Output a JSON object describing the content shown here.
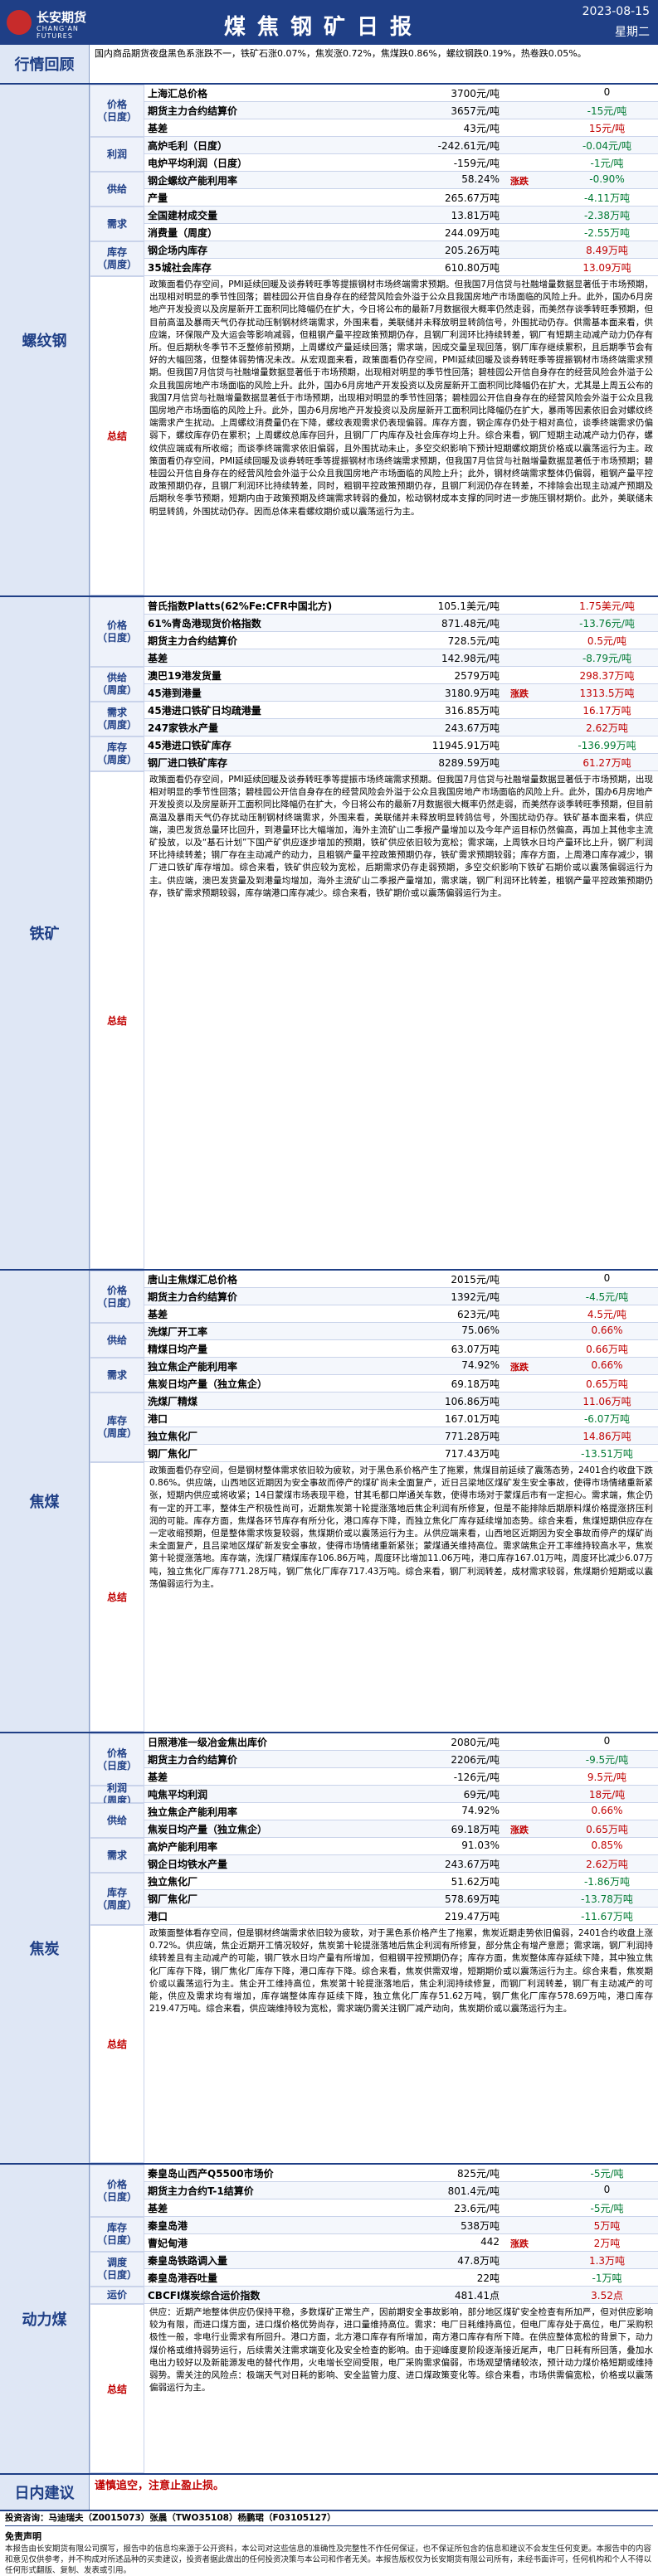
{
  "header": {
    "logo_name": "长安期货",
    "logo_en": "CHANG'AN FUTURES",
    "title": "煤焦钢矿日报",
    "date": "2023-08-15",
    "weekday": "星期二"
  },
  "colors": {
    "brand": "#1f3f86",
    "up": "#c00000",
    "down": "#007a33"
  },
  "market_review": {
    "label": "行情回顾",
    "text": "国内商品期货夜盘黑色系涨跌不一，铁矿石涨0.07%，焦炭涨0.72%，焦煤跌0.86%，螺纹钢跌0.19%，热卷跌0.05%。"
  },
  "rebar": {
    "label": "螺纹钢",
    "groups": [
      {
        "name": "价格\n（日度）",
        "start": 0,
        "count": 3
      },
      {
        "name": "利润",
        "start": 3,
        "count": 2
      },
      {
        "name": "供给",
        "start": 5,
        "count": 2
      },
      {
        "name": "需求",
        "start": 7,
        "count": 2
      },
      {
        "name": "库存\n（周度）",
        "start": 9,
        "count": 2
      }
    ],
    "trend_label": "涨跌",
    "rows": [
      {
        "label": "上海汇总价格",
        "value": "3700元/吨",
        "change": "0",
        "dir": "flat"
      },
      {
        "label": "期货主力合约结算价",
        "value": "3657元/吨",
        "change": "-15元/吨",
        "dir": "dn"
      },
      {
        "label": "基差",
        "value": "43元/吨",
        "change": "15元/吨",
        "dir": "up"
      },
      {
        "label": "高炉毛利（日度）",
        "value": "-242.61元/吨",
        "change": "-0.04元/吨",
        "dir": "dn"
      },
      {
        "label": "电炉平均利润（日度）",
        "value": "-159元/吨",
        "change": "-1元/吨",
        "dir": "dn"
      },
      {
        "label": "钢企螺纹产能利用率",
        "value": "58.24%",
        "change": "-0.90%",
        "dir": "dn"
      },
      {
        "label": "产量",
        "value": "265.67万吨",
        "change": "-4.11万吨",
        "dir": "dn"
      },
      {
        "label": "全国建材成交量",
        "value": "13.81万吨",
        "change": "-2.38万吨",
        "dir": "dn"
      },
      {
        "label": "消费量（周度）",
        "value": "244.09万吨",
        "change": "-2.55万吨",
        "dir": "dn"
      },
      {
        "label": "钢企场内库存",
        "value": "205.26万吨",
        "change": "8.49万吨",
        "dir": "up"
      },
      {
        "label": "35城社会库存",
        "value": "610.80万吨",
        "change": "13.09万吨",
        "dir": "up"
      }
    ],
    "summary_label": "总结",
    "summary": "政策面看仍存空间，PMI延续回暖及谈券转旺季等提振钢材市场终端需求预期。但我国7月信贷与社融增量数据显著低于市场预期，出现相对明显的季节性回落；碧桂园公开信自身存在的经营风险会外溢于公众且我国房地产市场面临的风险上升。此外，国办6月房地产开发投资以及房屋新开工面积同比降幅仍在扩大，今日将公布的最新7月数据很大概率仍然走弱，而美然存谈季转旺季预期，但目前高温及暴雨天气仍存扰动压制钢材终端需求，外围来看，美联储并未释放明显转鸽信号，外围扰动仍存。供需基本面来看，供应端，环保限产及大运会等影响减弱，但粗钢产量平控政策预期仍存，且钢厂利润环比持续转差，钢厂有短期主动减产动力仍存有所。但后期秋冬季节不乏整修前预期，上周螺纹产量延续回落；需求端，因成交量呈现回落，钢厂库存继续累积，且后期季节会有好的大幅回落，但整体弱势情况未改。从宏观面来看，政策面看仍存空间，PMI延续回暖及谈券转旺季等提振钢材市场终端需求预期。但我国7月信贷与社融增量数据显著低于市场预期，出现相对明显的季节性回落；碧桂园公开信自身存在的经营风险会外溢于公众且我国房地产市场面临的风险上升。此外，国办6月房地产开发投资以及房屋新开工面积同比降幅仍在扩大，尤其是上周五公布的我国7月信贷与社融增量数据显著低于市场预期，出现相对明显的季节性回落；碧桂园公开信自身存在的经营风险会外溢于公众且我国房地产市场面临的风险上升。此外，国办6月房地产开发投资以及房屋新开工面积同比降幅仍在扩大，暴雨等因素依旧会对螺纹终端需求产生扰动。上周螺纹消费量仍在下降，螺纹表观需求仍表现偏弱。库存方面，钢企库存仍处于相对高位，谈季终端需求仍偏弱下，螺纹库存仍在累积；上周螺纹总库存回升，且钢厂厂内库存及社会库存均上升。综合来看，钢厂短期主动减产动力仍存，螺纹供应端或有所收缩；而谈季终端需求依旧偏弱，且外围扰动未止，多空交织影响下预计短期螺纹期货价格或以震荡运行为主。政策面看仍存空间，PMI延续回暖及谈券转旺季等提振钢材市场终端需求预期，但我国7月信贷与社融增量数据显著低于市场预期；碧桂园公开信自身存在的经营风险会外溢于公众且我国房地产市场面临的风险上升；此外，钢材终端需求整体仍偏弱，粗钢产量平控政策预期仍存，且钢厂利润环比持续转差，同时，粗钢平控政策预期仍存，且钢厂利润仍存在转差，不排除会出现主动减产预期及后期秋冬季节预期，短期内由于政策预期及终端需求转弱的叠加，松动钢材成本支撑的同时进一步施压钢材期价。此外，美联储未明显转鸽，外围扰动仍存。因而总体来看螺纹期价或以震荡运行为主。"
  },
  "iron_ore": {
    "label": "铁矿",
    "groups": [
      {
        "name": "价格\n（日度）",
        "start": 0,
        "count": 4
      },
      {
        "name": "供给\n（周度）",
        "start": 4,
        "count": 2
      },
      {
        "name": "需求\n（周度）",
        "start": 6,
        "count": 2
      },
      {
        "name": "库存\n（周度）",
        "start": 8,
        "count": 2
      }
    ],
    "trend_label": "涨跌",
    "rows": [
      {
        "label": "普氏指数Platts(62%Fe:CFR中国北方)",
        "value": "105.1美元/吨",
        "change": "1.75美元/吨",
        "dir": "up"
      },
      {
        "label": "61%青岛港现货价格指数",
        "value": "871.48元/吨",
        "change": "-13.76元/吨",
        "dir": "dn"
      },
      {
        "label": "期货主力合约结算价",
        "value": "728.5元/吨",
        "change": "0.5元/吨",
        "dir": "up"
      },
      {
        "label": "基差",
        "value": "142.98元/吨",
        "change": "-8.79元/吨",
        "dir": "dn"
      },
      {
        "label": "澳巴19港发货量",
        "value": "2579万吨",
        "change": "298.37万吨",
        "dir": "up"
      },
      {
        "label": "45港到港量",
        "value": "3180.9万吨",
        "change": "1313.5万吨",
        "dir": "up"
      },
      {
        "label": "45港进口铁矿日均疏港量",
        "value": "316.85万吨",
        "change": "16.17万吨",
        "dir": "up"
      },
      {
        "label": "247家铁水产量",
        "value": "243.67万吨",
        "change": "2.62万吨",
        "dir": "up"
      },
      {
        "label": "45港进口铁矿库存",
        "value": "11945.91万吨",
        "change": "-136.99万吨",
        "dir": "dn"
      },
      {
        "label": "钢厂进口铁矿库存",
        "value": "8289.59万吨",
        "change": "61.27万吨",
        "dir": "up"
      }
    ],
    "summary_label": "总结",
    "summary": "政策面看仍存空间，PMI延续回暖及谈券转旺季等提振市场终端需求预期。但我国7月信贷与社融增量数据显著低于市场预期，出现相对明显的季节性回落；碧桂园公开信自身存在的经营风险会外溢于公众且我国房地产市场面临的风险上升。此外，国办6月房地产开发投资以及房屋新开工面积同比降幅仍在扩大，今日将公布的最新7月数据很大概率仍然走弱，而美然存谈季转旺季预期，但目前高温及暴雨天气仍存扰动压制钢材终端需求，外围来看，美联储并未释放明显转鸽信号，外围扰动仍存。铁矿基本面来看，供应端，澳巴发货总量环比回升，到港量环比大幅增加，海外主流矿山二季报产量增加以及今年产运目标仍然偏高，再加上其他非主流矿投放，以及“基石计划”下国产矿供应逐步增加的预期，铁矿供应依旧较为宽松；需求端，上周铁水日均产量环比上升，钢厂利润环比持续转差；钢厂存在主动减产的动力，且粗钢产量平控政策预期仍存，铁矿需求预期较弱；库存方面，上周港口库存减少，钢厂进口铁矿库存增加。综合来看，铁矿供应较为宽松，后期需求仍存走弱预期，多空交织影响下铁矿石期价或以震荡偏弱运行为主。供应端，澳巴发货量及到港量均增加，海外主流矿山二季报产量增加，需求端，钢厂利润环比转差，粗钢产量平控政策预期仍存，铁矿需求预期较弱，库存端港口库存减少。综合来看，铁矿期价或以震荡偏弱运行为主。"
  },
  "coking_coal": {
    "label": "焦煤",
    "groups": [
      {
        "name": "价格\n（日度）",
        "start": 0,
        "count": 3
      },
      {
        "name": "供给",
        "start": 3,
        "count": 2
      },
      {
        "name": "需求",
        "start": 5,
        "count": 2
      },
      {
        "name": "库存\n（周度）",
        "start": 7,
        "count": 4
      }
    ],
    "trend_label": "涨跌",
    "rows": [
      {
        "label": "唐山主焦煤汇总价格",
        "value": "2015元/吨",
        "change": "0",
        "dir": "flat"
      },
      {
        "label": "期货主力合约结算价",
        "value": "1392元/吨",
        "change": "-4.5元/吨",
        "dir": "dn"
      },
      {
        "label": "基差",
        "value": "623元/吨",
        "change": "4.5元/吨",
        "dir": "up"
      },
      {
        "label": "洗煤厂开工率",
        "value": "75.06%",
        "change": "0.66%",
        "dir": "up"
      },
      {
        "label": "精煤日均产量",
        "value": "63.07万吨",
        "change": "0.66万吨",
        "dir": "up"
      },
      {
        "label": "独立焦企产能利用率",
        "value": "74.92%",
        "change": "0.66%",
        "dir": "up"
      },
      {
        "label": "焦炭日均产量（独立焦企）",
        "value": "69.18万吨",
        "change": "0.65万吨",
        "dir": "up"
      },
      {
        "label": "洗煤厂精煤",
        "value": "106.86万吨",
        "change": "11.06万吨",
        "dir": "up"
      },
      {
        "label": "港口",
        "value": "167.01万吨",
        "change": "-6.07万吨",
        "dir": "dn"
      },
      {
        "label": "独立焦化厂",
        "value": "771.28万吨",
        "change": "14.86万吨",
        "dir": "up"
      },
      {
        "label": "钢厂焦化厂",
        "value": "717.43万吨",
        "change": "-13.51万吨",
        "dir": "dn"
      }
    ],
    "summary_label": "总结",
    "summary": "政策面看仍存空间，但是钢材整体需求依旧较为疲软，对于黑色系价格产生了拖累，焦煤目前延续了震荡态势，2401合约收盘下跌0.86%。供应端，山西地区近期因为安全事故而停产的煤矿尚未全面复产，近日吕梁地区煤矿发生安全事故，使得市场情绪重新紧张，短期内供应或将收紧；14日蒙煤市场表现平稳，甘其毛都口岸通关车数，使得市场对于蒙煤后市有一定担心。需求端，焦企仍有一定的开工率，整体生产积极性尚可，近期焦炭第十轮提涨落地后焦企利润有所修复，但是不能排除后期原料煤价格提涨挤压利润的可能。库存方面，焦煤各环节库存有所分化，港口库存下降，而独立焦化厂库存延续增加态势。综合来看，焦煤短期供应存在一定收缩预期，但是整体需求恢复较弱，焦煤期价或以震荡运行为主。从供应端来看，山西地区近期因为安全事故而停产的煤矿尚未全面复产，且吕梁地区煤矿新发安全事故，使得市场情绪重新紧张；蒙煤通关维持高位。需求端焦企开工率维持较高水平，焦炭第十轮提涨落地。库存端，洗煤厂精煤库存106.86万吨，周度环比增加11.06万吨，港口库存167.01万吨，周度环比减少6.07万吨，独立焦化厂库存771.28万吨，钢厂焦化厂库存717.43万吨。综合来看，钢厂利润转差，成材需求较弱，焦煤期价短期或以震荡偏弱运行为主。"
  },
  "coke": {
    "label": "焦炭",
    "groups": [
      {
        "name": "价格\n（日度）",
        "start": 0,
        "count": 3
      },
      {
        "name": "利润\n（周度）",
        "start": 3,
        "count": 1
      },
      {
        "name": "供给",
        "start": 4,
        "count": 2
      },
      {
        "name": "需求",
        "start": 6,
        "count": 2
      },
      {
        "name": "库存\n（周度）",
        "start": 8,
        "count": 3
      }
    ],
    "trend_label": "涨跌",
    "rows": [
      {
        "label": "日照港准一级冶金焦出库价",
        "value": "2080元/吨",
        "change": "0",
        "dir": "flat"
      },
      {
        "label": "期货主力合约结算价",
        "value": "2206元/吨",
        "change": "-9.5元/吨",
        "dir": "dn"
      },
      {
        "label": "基差",
        "value": "-126元/吨",
        "change": "9.5元/吨",
        "dir": "up"
      },
      {
        "label": "吨焦平均利润",
        "value": "69元/吨",
        "change": "18元/吨",
        "dir": "up"
      },
      {
        "label": "独立焦企产能利用率",
        "value": "74.92%",
        "change": "0.66%",
        "dir": "up"
      },
      {
        "label": "焦炭日均产量（独立焦企）",
        "value": "69.18万吨",
        "change": "0.65万吨",
        "dir": "up"
      },
      {
        "label": "高炉产能利用率",
        "value": "91.03%",
        "change": "0.85%",
        "dir": "up"
      },
      {
        "label": "钢企日均铁水产量",
        "value": "243.67万吨",
        "change": "2.62万吨",
        "dir": "up"
      },
      {
        "label": "独立焦化厂",
        "value": "51.62万吨",
        "change": "-1.86万吨",
        "dir": "dn"
      },
      {
        "label": "钢厂焦化厂",
        "value": "578.69万吨",
        "change": "-13.78万吨",
        "dir": "dn"
      },
      {
        "label": "港口",
        "value": "219.47万吨",
        "change": "-11.67万吨",
        "dir": "dn"
      }
    ],
    "summary_label": "总结",
    "summary": "政策面整体看存空间，但是钢材终端需求依旧较为疲软，对于黑色系价格产生了拖累，焦炭近期走势依旧偏弱，2401合约收盘上涨0.72%。供应端，焦企近期开工情况较好，焦炭第十轮提涨落地后焦企利润有所修复，部分焦企有增产意愿；需求端，钢厂利润持续转差且有主动减产的可能，钢厂铁水日均产量有所增加，但粗钢平控预期仍存；库存方面，焦炭整体库存延续下降，其中独立焦化厂库存下降，钢厂焦化厂库存下降，港口库存下降。综合来看，焦炭供需双增，短期期价或以震荡运行为主。综合来看，焦炭期价或以震荡运行为主。焦企开工维持高位，焦炭第十轮提涨落地后，焦企利润持续修复，而钢厂利润转差，钢厂有主动减产的可能，供应及需求均有增加，库存端整体库存延续下降，独立焦化厂库存51.62万吨，钢厂焦化厂库存578.69万吨，港口库存219.47万吨。综合来看，供应端维持较为宽松，需求端仍需关注钢厂减产动向，焦炭期价或以震荡运行为主。"
  },
  "thermal_coal": {
    "label": "动力煤",
    "groups": [
      {
        "name": "价格\n（日度）",
        "start": 0,
        "count": 3
      },
      {
        "name": "库存\n（日度）",
        "start": 3,
        "count": 2
      },
      {
        "name": "调度\n（日度）",
        "start": 5,
        "count": 2
      },
      {
        "name": "运价",
        "start": 7,
        "count": 1
      }
    ],
    "trend_label": "涨跌",
    "rows": [
      {
        "label": "秦皇岛山西产Q5500市场价",
        "value": "825元/吨",
        "change": "-5元/吨",
        "dir": "dn"
      },
      {
        "label": "期货主力合约T-1结算价",
        "value": "801.4元/吨",
        "change": "0",
        "dir": "flat"
      },
      {
        "label": "基差",
        "value": "23.6元/吨",
        "change": "-5元/吨",
        "dir": "dn"
      },
      {
        "label": "秦皇岛港",
        "value": "538万吨",
        "change": "5万吨",
        "dir": "up"
      },
      {
        "label": "曹妃甸港",
        "value": "442",
        "change": "2万吨",
        "dir": "up"
      },
      {
        "label": "秦皇岛铁路调入量",
        "value": "47.8万吨",
        "change": "1.3万吨",
        "dir": "up"
      },
      {
        "label": "秦皇岛港吞吐量",
        "value": "22吨",
        "change": "-1万吨",
        "dir": "dn"
      },
      {
        "label": "CBCFI煤炭综合运价指数",
        "value": "481.41点",
        "change": "3.52点",
        "dir": "up"
      }
    ],
    "summary_label": "总结",
    "summary": "供应：近期产地整体供应仍保持平稳，多数煤矿正常生产，因前期安全事故影响，部分地区煤矿安全检查有所加严，但对供应影响较为有限，而进口煤方面，进口煤价格优势尚存，进口量维持高位。需求：电厂日耗维持高位，但电厂库存处于高位，电厂采购积极性一般，非电行业需求有所回升。港口方面，北方港口库存有所增加，南方港口库存有所下降。在供应整体宽松的背景下，动力煤价格或维持弱势运行，后续需关注需求端变化及安全检查的影响。由于迎峰度夏阶段逐渐接近尾声，电厂日耗有所回落，叠加水电出力较好以及新能源发电的替代作用，火电增长空间受限，电厂采购需求偏弱，市场观望情绪较浓，预计动力煤价格短期或维持弱势。需关注的风险点：极端天气对日耗的影响、安全监管力度、进口煤政策变化等。综合来看，市场供需偏宽松，价格或以震荡偏弱运行为主。"
  },
  "advice": {
    "label": "日内建议",
    "text": "谨慎追空，注意止盈止损。"
  },
  "footer": {
    "analysts": "投资咨询：马迪瑞夫（Z0015073）张晨（TWO35108）杨鹏珺（F03105127）",
    "disclaimer_title": "免责声明",
    "disclaimer_text": "本报告由长安期货有限公司撰写，报告中的信息均来源于公开资料，本公司对这些信息的准确性及完整性不作任何保证，也不保证所包含的信息和建议不会发生任何变更。本报告中的内容和意见仅供参考，并不构成对所述品种的买卖建议，投资者据此做出的任何投资决策与本公司和作者无关。本报告版权仅为长安期货有限公司所有，未经书面许可，任何机构和个人不得以任何形式翻版、复制、发表或引用。"
  }
}
